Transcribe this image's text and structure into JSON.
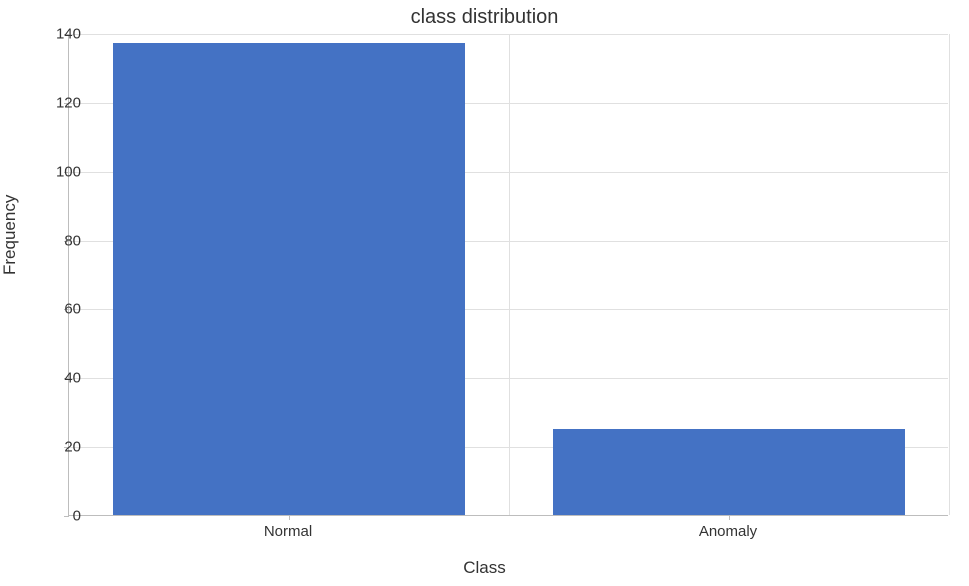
{
  "chart_data": {
    "type": "bar",
    "categories": [
      "Normal",
      "Anomaly"
    ],
    "values": [
      137,
      25
    ],
    "title": "class distribution",
    "xlabel": "Class",
    "ylabel": "Frequency",
    "ylim": [
      0,
      140
    ],
    "yticks": [
      0,
      20,
      40,
      60,
      80,
      100,
      120,
      140
    ],
    "bar_color": "#4472c4"
  }
}
